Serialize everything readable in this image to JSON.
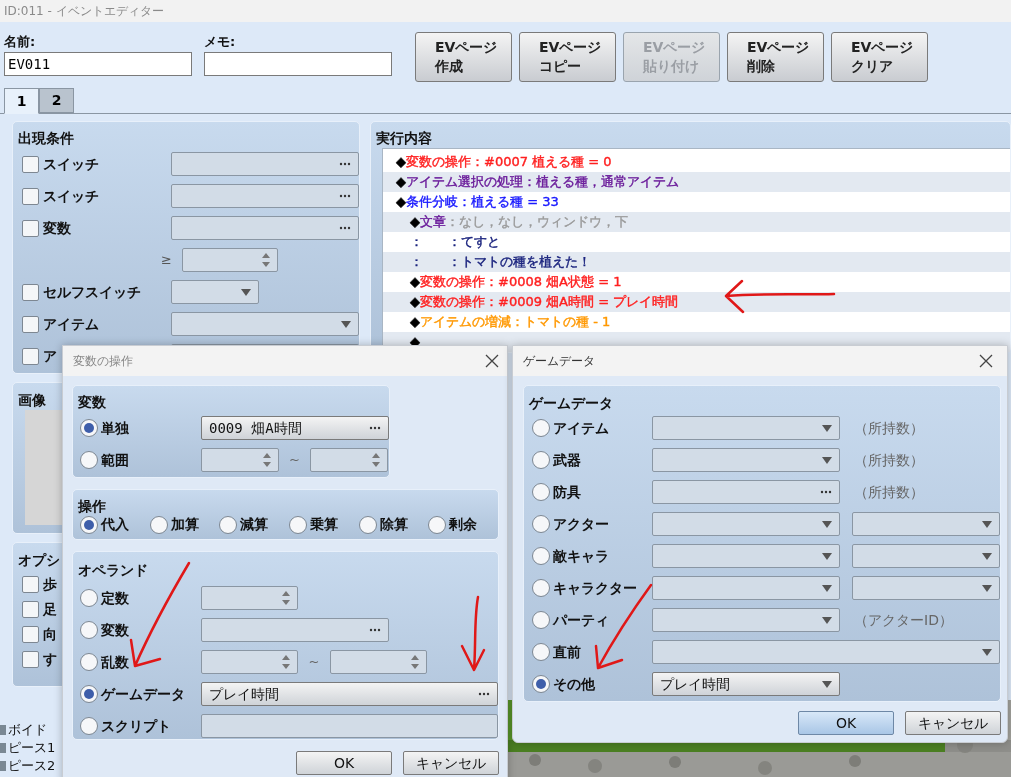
{
  "window": {
    "title": "ID:011 - イベントエディター"
  },
  "name_field": {
    "label": "名前:",
    "value": "EV011"
  },
  "memo_field": {
    "label": "メモ:"
  },
  "page_buttons": [
    {
      "line1": "EVページ",
      "line2": "作成",
      "disabled": false
    },
    {
      "line1": "EVページ",
      "line2": "コピー",
      "disabled": false
    },
    {
      "line1": "EVページ",
      "line2": "貼り付け",
      "disabled": true
    },
    {
      "line1": "EVページ",
      "line2": "削除",
      "disabled": false
    },
    {
      "line1": "EVページ",
      "line2": "クリア",
      "disabled": false
    }
  ],
  "page_tabs": [
    {
      "label": "1",
      "selected": true
    },
    {
      "label": "2",
      "selected": false
    }
  ],
  "conditions": {
    "title": "出現条件",
    "rows": [
      {
        "kind": "picker",
        "label": "スイッチ",
        "checked": false
      },
      {
        "kind": "picker",
        "label": "スイッチ",
        "checked": false
      },
      {
        "kind": "picker",
        "label": "変数",
        "checked": false
      },
      {
        "kind": "compare",
        "symbol": "≥"
      },
      {
        "kind": "select_short",
        "label": "セルフスイッチ",
        "checked": false
      },
      {
        "kind": "select",
        "label": "アイテム",
        "checked": false
      },
      {
        "kind": "covered",
        "label": "ア",
        "checked": false
      }
    ]
  },
  "image": {
    "title": "画像"
  },
  "options": {
    "title": "オプシ",
    "rows": [
      {
        "label": "歩",
        "checked": false
      },
      {
        "label": "足",
        "checked": false
      },
      {
        "label": "向",
        "checked": false
      },
      {
        "label": "す",
        "checked": false
      }
    ]
  },
  "tree": [
    {
      "label": "ボイド"
    },
    {
      "label": "ピース1"
    },
    {
      "label": "ピース2"
    }
  ],
  "contents": {
    "title": "実行内容",
    "lines": [
      {
        "segments": [
          {
            "text": "◆",
            "color": "#000000"
          },
          {
            "text": "変数の操作：#0007 植える種 = 0",
            "color": "#ff2020"
          }
        ]
      },
      {
        "segments": [
          {
            "text": "◆",
            "color": "#000000"
          },
          {
            "text": "アイテム選択の処理：植える種，通常アイテム",
            "color": "#6a1b9a"
          }
        ]
      },
      {
        "segments": [
          {
            "text": "◆",
            "color": "#000000"
          },
          {
            "text": "条件分岐：植える種 = 33",
            "color": "#1a1aff"
          }
        ],
        "children": [
          {
            "segments": [
              {
                "text": "◆",
                "color": "#000000"
              },
              {
                "text": "文章",
                "color": "#6a1b9a"
              },
              {
                "text": "：なし，なし，ウィンドウ，下",
                "color": "#9a9a9a"
              }
            ]
          },
          {
            "segments": [
              {
                "text": "：      ：てすと",
                "color": "#1a237e"
              }
            ]
          },
          {
            "segments": [
              {
                "text": "：      ：トマトの種を植えた！",
                "color": "#1a237e"
              }
            ]
          },
          {
            "segments": [
              {
                "text": "◆",
                "color": "#000000"
              },
              {
                "text": "変数の操作：#0008 畑A状態 = 1",
                "color": "#ff2020"
              }
            ]
          },
          {
            "segments": [
              {
                "text": "◆",
                "color": "#000000"
              },
              {
                "text": "変数の操作：#0009 畑A時間 = プレイ時間",
                "color": "#ff2020"
              }
            ]
          },
          {
            "segments": [
              {
                "text": "◆",
                "color": "#000000"
              },
              {
                "text": "アイテムの増減：トマトの種 - 1",
                "color": "#ff9800"
              }
            ]
          },
          {
            "segments": [
              {
                "text": "◆",
                "color": "#000000"
              }
            ]
          }
        ]
      }
    ]
  },
  "variable_dialog": {
    "title": "変数の操作",
    "variable": {
      "title": "変数",
      "options": [
        {
          "kind": "picker",
          "label": "単独",
          "selected": true,
          "value": "0009 畑A時間"
        },
        {
          "kind": "range",
          "label": "範囲",
          "selected": false,
          "separator": "~"
        }
      ]
    },
    "operation": {
      "title": "操作",
      "options": [
        {
          "label": "代入",
          "selected": true
        },
        {
          "label": "加算",
          "selected": false
        },
        {
          "label": "減算",
          "selected": false
        },
        {
          "label": "乗算",
          "selected": false
        },
        {
          "label": "除算",
          "selected": false
        },
        {
          "label": "剰余",
          "selected": false
        }
      ]
    },
    "operand": {
      "title": "オペランド",
      "options": [
        {
          "kind": "spinner",
          "label": "定数",
          "selected": false
        },
        {
          "kind": "picker",
          "label": "変数",
          "selected": false
        },
        {
          "kind": "range",
          "label": "乱数",
          "selected": false,
          "separator": "~"
        },
        {
          "kind": "picker_wide",
          "label": "ゲームデータ",
          "selected": true,
          "value": "プレイ時間"
        },
        {
          "kind": "text",
          "label": "スクリプト",
          "selected": false
        }
      ]
    },
    "buttons": [
      "OK",
      "キャンセル"
    ]
  },
  "game_data_dialog": {
    "title": "ゲームデータ",
    "group_title": "ゲームデータ",
    "options": [
      {
        "kind": "select_note",
        "label": "アイテム",
        "selected": false,
        "note": "（所持数）"
      },
      {
        "kind": "select_note",
        "label": "武器",
        "selected": false,
        "note": "（所持数）"
      },
      {
        "kind": "picker_note",
        "label": "防具",
        "selected": false,
        "note": "（所持数）"
      },
      {
        "kind": "select_pair",
        "label": "アクター",
        "selected": false
      },
      {
        "kind": "select_pair",
        "label": "敵キャラ",
        "selected": false
      },
      {
        "kind": "select_pair",
        "label": "キャラクター",
        "selected": false
      },
      {
        "kind": "select_note",
        "label": "パーティ",
        "selected": false,
        "note": "（アクターID）"
      },
      {
        "kind": "select_full",
        "label": "直前",
        "selected": false
      },
      {
        "kind": "select",
        "label": "その他",
        "selected": true,
        "value": "プレイ時間"
      }
    ],
    "buttons": [
      {
        "label": "OK",
        "default": true
      },
      {
        "label": "キャンセル",
        "default": false
      }
    ]
  }
}
